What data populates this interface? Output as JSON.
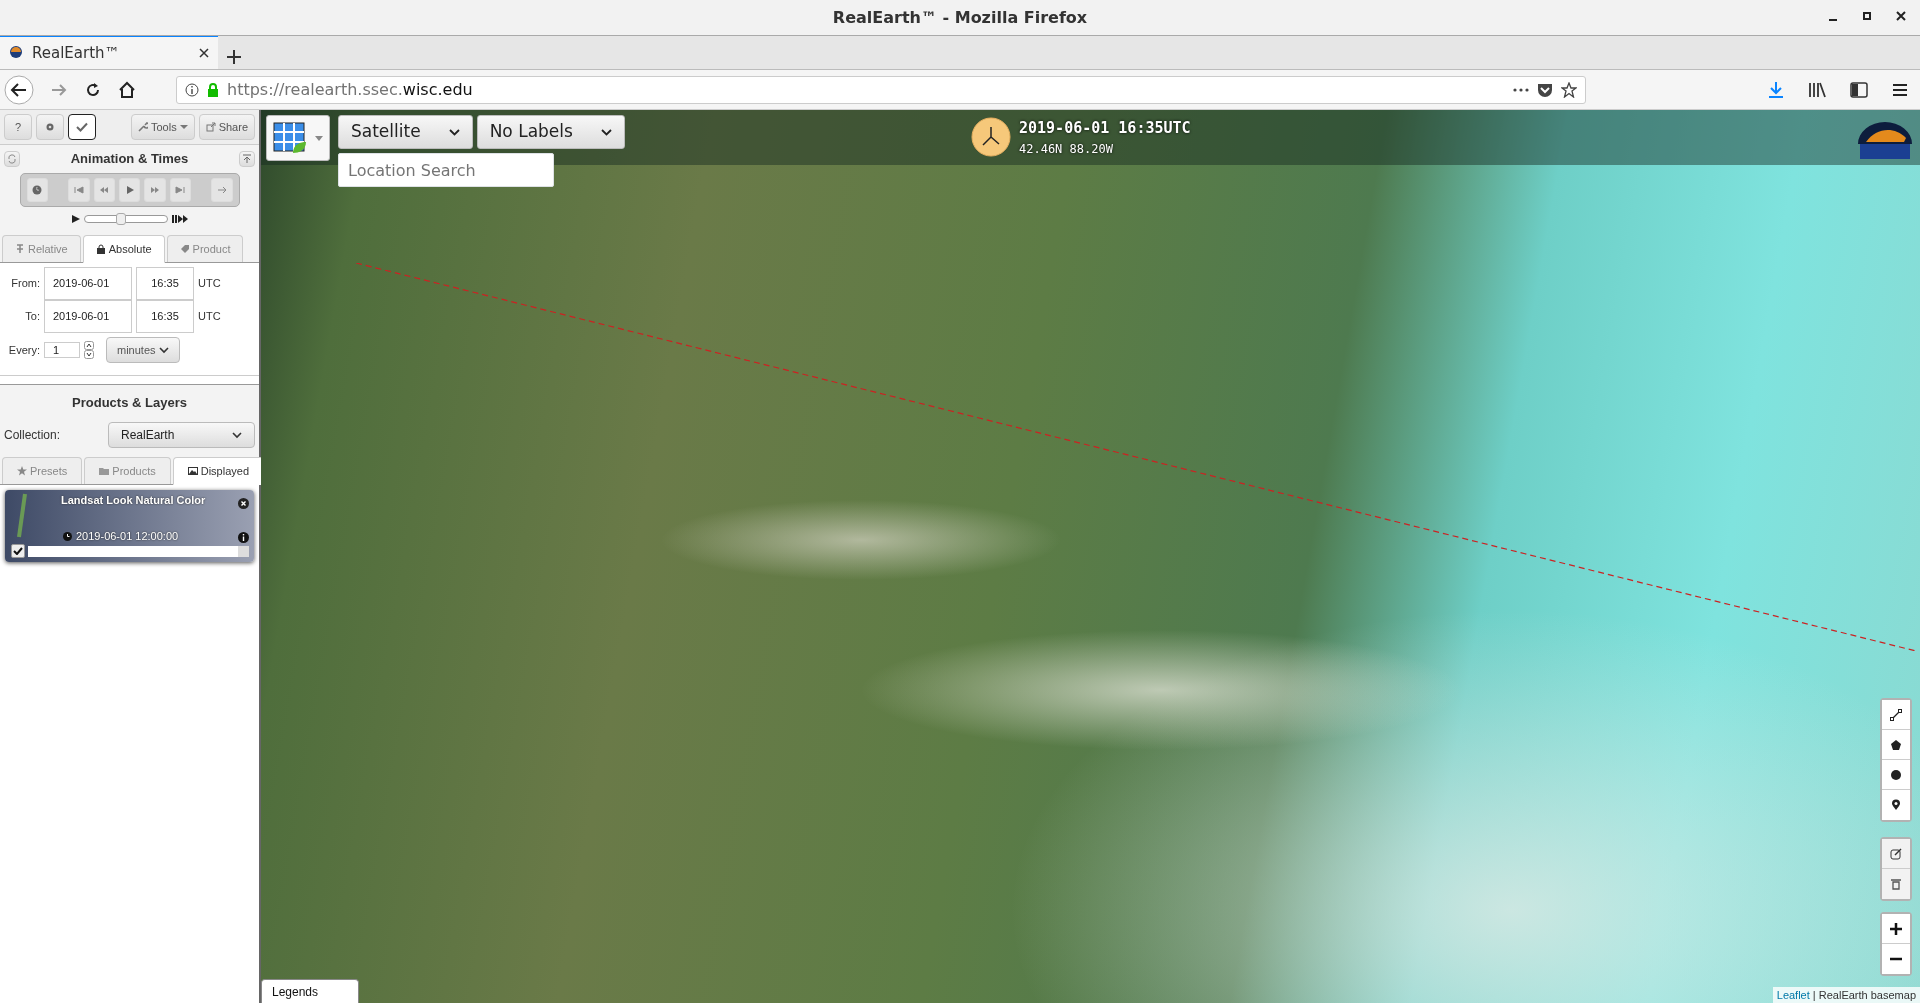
{
  "window": {
    "title": "RealEarth™ - Mozilla Firefox"
  },
  "browser": {
    "tab": "RealEarth™",
    "url_prefix": "https://realearth.ssec.",
    "url_domain": "wisc.edu"
  },
  "sidebar": {
    "toggles": [
      {
        "label": "?",
        "on": false
      },
      {
        "on": false
      },
      {
        "on": true
      }
    ],
    "tools_button": "Tools",
    "share_button": "Share",
    "animation": {
      "title": "Animation & Times",
      "speed": {
        "level": 0.45
      },
      "tabs": [
        {
          "label": "Relative",
          "selected": false
        },
        {
          "label": "Absolute",
          "selected": true
        },
        {
          "label": "Product",
          "selected": false
        }
      ],
      "from_label": "From:",
      "from_date": "2019-06-01",
      "from_time": "16:35",
      "from_tz": "UTC",
      "to_label": "To:",
      "to_date": "2019-06-01",
      "to_time": "16:35",
      "to_tz": "UTC",
      "every_label": "Every:",
      "every_value": "1",
      "unit": "minutes"
    },
    "products": {
      "title": "Products & Layers",
      "collection_label": "Collection:",
      "collection": "RealEarth",
      "tabs": [
        {
          "label": "Presets",
          "selected": false
        },
        {
          "label": "Products",
          "selected": false
        },
        {
          "label": "Displayed",
          "selected": true
        }
      ],
      "layers": [
        {
          "name": "Landsat Look Natural Color",
          "time": "2019-06-01 12:00:00",
          "checked": true,
          "level": 0.95
        }
      ]
    }
  },
  "map": {
    "basemap": "Satellite",
    "labels": "No Labels",
    "search_placeholder": "Location Search",
    "datetime": "2019-06-01 16:35UTC",
    "coords": "42.46N 88.20W",
    "legends": "Legends",
    "attribution_link": "Leaflet",
    "attribution": "| RealEarth basemap"
  }
}
